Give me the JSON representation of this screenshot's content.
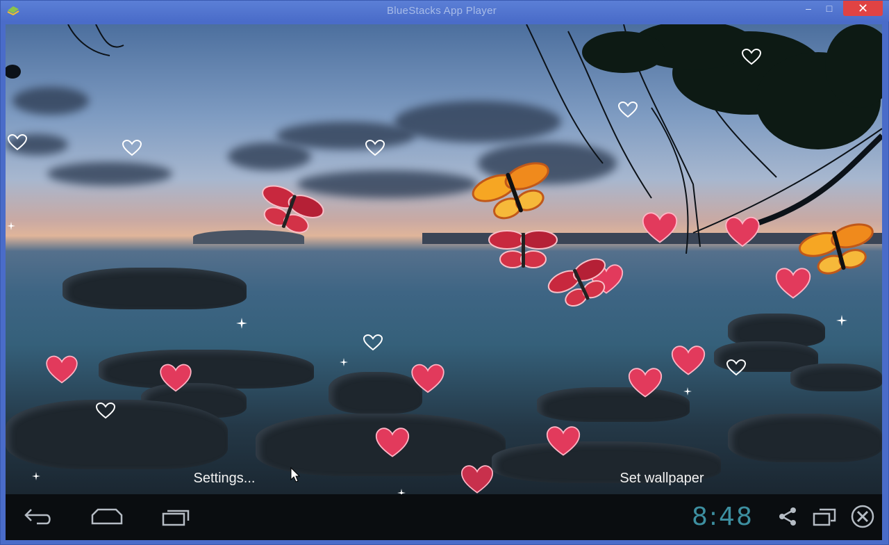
{
  "window": {
    "title": "BlueStacks App Player",
    "min_label": "–",
    "max_label": "□",
    "close_label": "✕"
  },
  "wallpaper_actions": {
    "settings_label": "Settings...",
    "set_wallpaper_label": "Set wallpaper"
  },
  "navbar": {
    "back_icon": "back-icon",
    "home_icon": "home-icon",
    "recent_icon": "recent-apps-icon",
    "clock": "8:48",
    "share_icon": "share-icon",
    "screen_icon": "screen-rotate-icon",
    "close_icon": "close-circle-icon"
  },
  "colors": {
    "titlebar": "#4a6cc9",
    "close_button": "#e04343",
    "clock": "#3d8fa0",
    "heart": "#e23a5c"
  }
}
